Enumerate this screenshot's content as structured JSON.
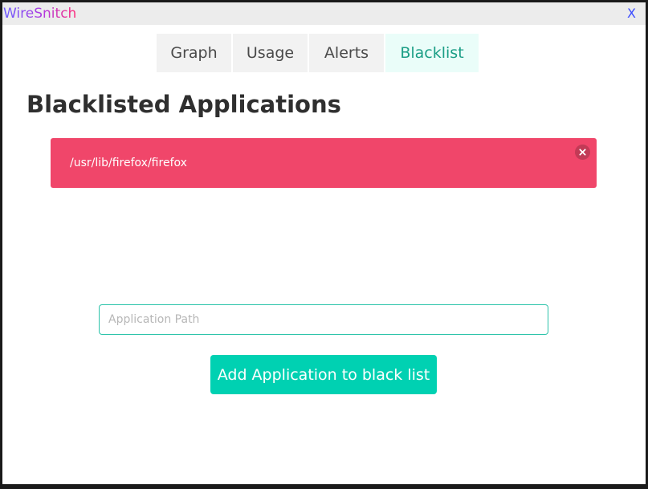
{
  "window": {
    "title": "WireSnitch",
    "close_label": "X"
  },
  "tabs": [
    {
      "label": "Graph",
      "active": false
    },
    {
      "label": "Usage",
      "active": false
    },
    {
      "label": "Alerts",
      "active": false
    },
    {
      "label": "Blacklist",
      "active": true
    }
  ],
  "page": {
    "title": "Blacklisted Applications"
  },
  "blacklist": {
    "items": [
      {
        "path": "/usr/lib/firefox/firefox"
      }
    ]
  },
  "form": {
    "input_placeholder": "Application Path",
    "input_value": "",
    "add_button_label": "Add Application to black list"
  },
  "colors": {
    "accent": "#00d1b2",
    "danger": "#f0466a",
    "active_tab_text": "#1b9e86",
    "close_x": "#3b4cff"
  }
}
